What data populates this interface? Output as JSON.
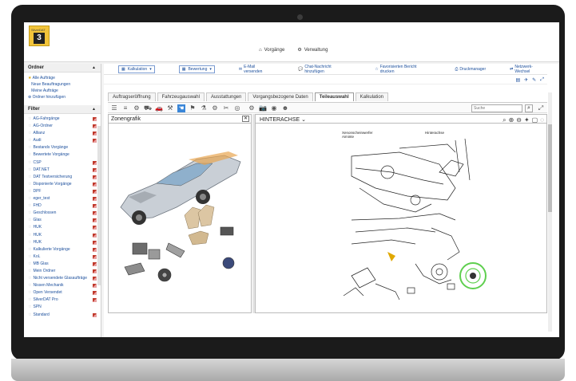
{
  "app": {
    "logo_top": "SilverDAT",
    "logo_number": "3"
  },
  "topnav": {
    "vorgaenge": "Vorgänge",
    "verwaltung": "Verwaltung"
  },
  "sidebar": {
    "ordner_title": "Ordner",
    "ordner_items": [
      "Alle Aufträge",
      "Neue Beauftragungen",
      "Meine Aufträge",
      "Ordner hinzufügen"
    ],
    "filter_title": "Filter",
    "filter_items": [
      "AG-Fahrgänge",
      "AG-Ordner",
      "Allianz",
      "Audi",
      "Bestands Vorgänge",
      "Bewertete Vorgänge",
      "CSP",
      "DAT.NET",
      "DAT Testversicherung",
      "Disponierte Vorgänge",
      "DPF",
      "eger_test",
      "FHD",
      "Geschlossen",
      "Glas",
      "HUK",
      "HUK",
      "HUK",
      "Kalkulierte Vorgänge",
      "KoL",
      "MB Glas",
      "Mein Ordner",
      "Nicht versendete Glasaufträge",
      "Nissen Mechanik",
      "Open Versendet",
      "SilverDAT Pro",
      "SPN",
      "Standard"
    ]
  },
  "actionbar": {
    "kalkulation": "Kalkulation",
    "bewertung": "Bewertung",
    "email": "E-Mail versenden",
    "chat": "Chat-Nachricht hinzufügen",
    "favoriten": "Favorisierten Bericht drucken",
    "druckmanager": "Druckmanager",
    "netzwerk": "Netzwerk-Wechsel"
  },
  "tabs": [
    "Auftragseröffnung",
    "Fahrzeugauswahl",
    "Ausstattungen",
    "Vorgangsbezogene Daten",
    "Teileauswahl",
    "Kalkulation"
  ],
  "active_tab": "Teileauswahl",
  "search": {
    "placeholder": "Suche"
  },
  "left_pane": {
    "title": "Zonengrafik"
  },
  "right_pane": {
    "group_selected": "HINTERACHSE",
    "diagram_labels": [
      "Xenonscheinwerfer Aiminte",
      "Hinterachse"
    ]
  },
  "colors": {
    "accent_blue": "#3a86d8",
    "link_blue": "#1c4f9c",
    "logo_yellow": "#f2c43a",
    "highlight_green": "#5fcf4f"
  }
}
